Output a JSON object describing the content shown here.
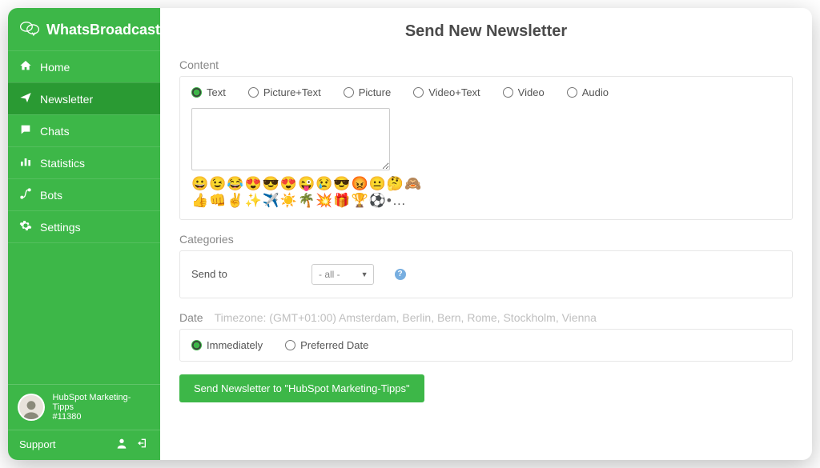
{
  "brand": {
    "name": "WhatsBroadcast"
  },
  "sidebar": {
    "items": [
      {
        "label": "Home",
        "icon": "home-icon",
        "active": false
      },
      {
        "label": "Newsletter",
        "icon": "send-icon",
        "active": true
      },
      {
        "label": "Chats",
        "icon": "chat-bubble-icon",
        "active": false
      },
      {
        "label": "Statistics",
        "icon": "bar-chart-icon",
        "active": false
      },
      {
        "label": "Bots",
        "icon": "route-icon",
        "active": false
      },
      {
        "label": "Settings",
        "icon": "gear-icon",
        "active": false
      }
    ],
    "user": {
      "name": "HubSpot Marketing-Tipps",
      "id": "#11380"
    },
    "support": "Support"
  },
  "page": {
    "title": "Send New Newsletter",
    "content_label": "Content",
    "content_types": [
      "Text",
      "Picture+Text",
      "Picture",
      "Video+Text",
      "Video",
      "Audio"
    ],
    "content_selected": "Text",
    "message_value": "",
    "emoji_row1": [
      "😀",
      "😉",
      "😂",
      "😍",
      "😎",
      "😍",
      "😜",
      "😢",
      "😎",
      "😡",
      "😐",
      "🤔",
      "🙈"
    ],
    "emoji_row2": [
      "👍",
      "👊",
      "✌️",
      "✨",
      "✈️",
      "☀️",
      "🌴",
      "💥",
      "🎁",
      "🏆",
      "⚽",
      "•",
      "…"
    ],
    "categories_label": "Categories",
    "send_to_label": "Send to",
    "send_to_value": "- all -",
    "date_label": "Date",
    "timezone": "Timezone: (GMT+01:00) Amsterdam, Berlin, Bern, Rome, Stockholm, Vienna",
    "date_options": [
      "Immediately",
      "Preferred Date"
    ],
    "date_selected": "Immediately",
    "submit_label": "Send Newsletter to \"HubSpot Marketing-Tipps\""
  }
}
